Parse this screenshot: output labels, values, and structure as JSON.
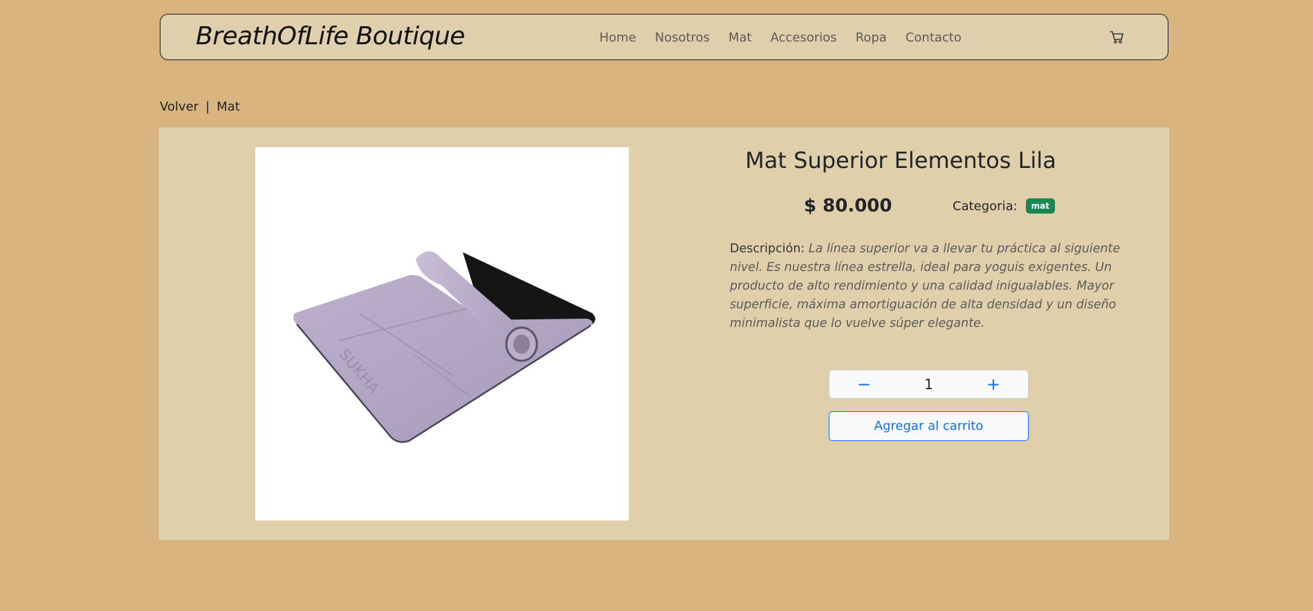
{
  "navbar": {
    "brand": "BreathOfLife Boutique",
    "links": [
      "Home",
      "Nosotros",
      "Mat",
      "Accesorios",
      "Ropa",
      "Contacto"
    ],
    "cart_icon": "cart-icon"
  },
  "breadcrumb": {
    "back": "Volver",
    "separator": "|",
    "current": "Mat"
  },
  "product": {
    "title": "Mat Superior Elementos Lila",
    "price": "$ 80.000",
    "category_label": "Categoria:",
    "category_badge": "mat",
    "description_label": "Descripción:",
    "description": "La línea superior va a llevar tu práctica al siguiente nivel. Es nuestra línea estrella, ideal para yoguis exigentes. Un producto de alto rendimiento y una calidad inigualables. Mayor superficie, máxima amortiguación de alta densidad y un diseño minimalista que lo vuelve súper elegante.",
    "mat_print": "SUKHA",
    "quantity": "1",
    "decrement": "−",
    "increment": "+",
    "add_to_cart": "Agregar al carrito"
  },
  "colors": {
    "page_bg": "#d9b47f",
    "card_bg": "#e0cfab",
    "badge_bg": "#198754",
    "primary": "#0d6efd"
  }
}
